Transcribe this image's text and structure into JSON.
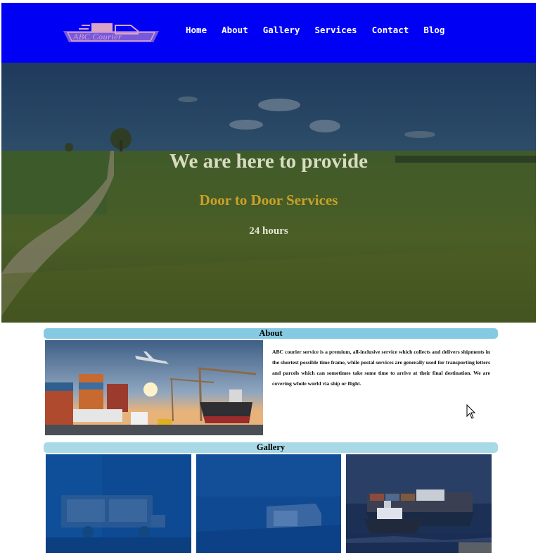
{
  "logo": {
    "text": "ABC Courier",
    "icon": "truck-icon"
  },
  "nav": {
    "items": [
      {
        "label": "Home"
      },
      {
        "label": "About"
      },
      {
        "label": "Gallery"
      },
      {
        "label": "Services"
      },
      {
        "label": "Contact"
      },
      {
        "label": "Blog"
      }
    ]
  },
  "hero": {
    "title": "We are here to provide",
    "subtitle": "Door to Door Services",
    "hours": "24 hours"
  },
  "about": {
    "heading": "About",
    "image_alt": "cargo port with airplane, ship and containers",
    "text": "ABC courier service is a premium, all-inclusive service which collects and delivers shipments in the shortest possible time frame, while postal services are generally used for transporting letters and parcels which can sometimes take some time to arrive at their final destination. We are covering whole world via ship or flight."
  },
  "gallery": {
    "heading": "Gallery",
    "tiles": [
      {
        "alt": "delivery truck"
      },
      {
        "alt": "delivery van"
      },
      {
        "alt": "cargo ship with tugboat"
      }
    ]
  },
  "colors": {
    "header_bg": "#0000f5",
    "section_bar": "#86c9e3",
    "hero_title": "#d8dcbf",
    "hero_subtitle": "#c9a227"
  }
}
